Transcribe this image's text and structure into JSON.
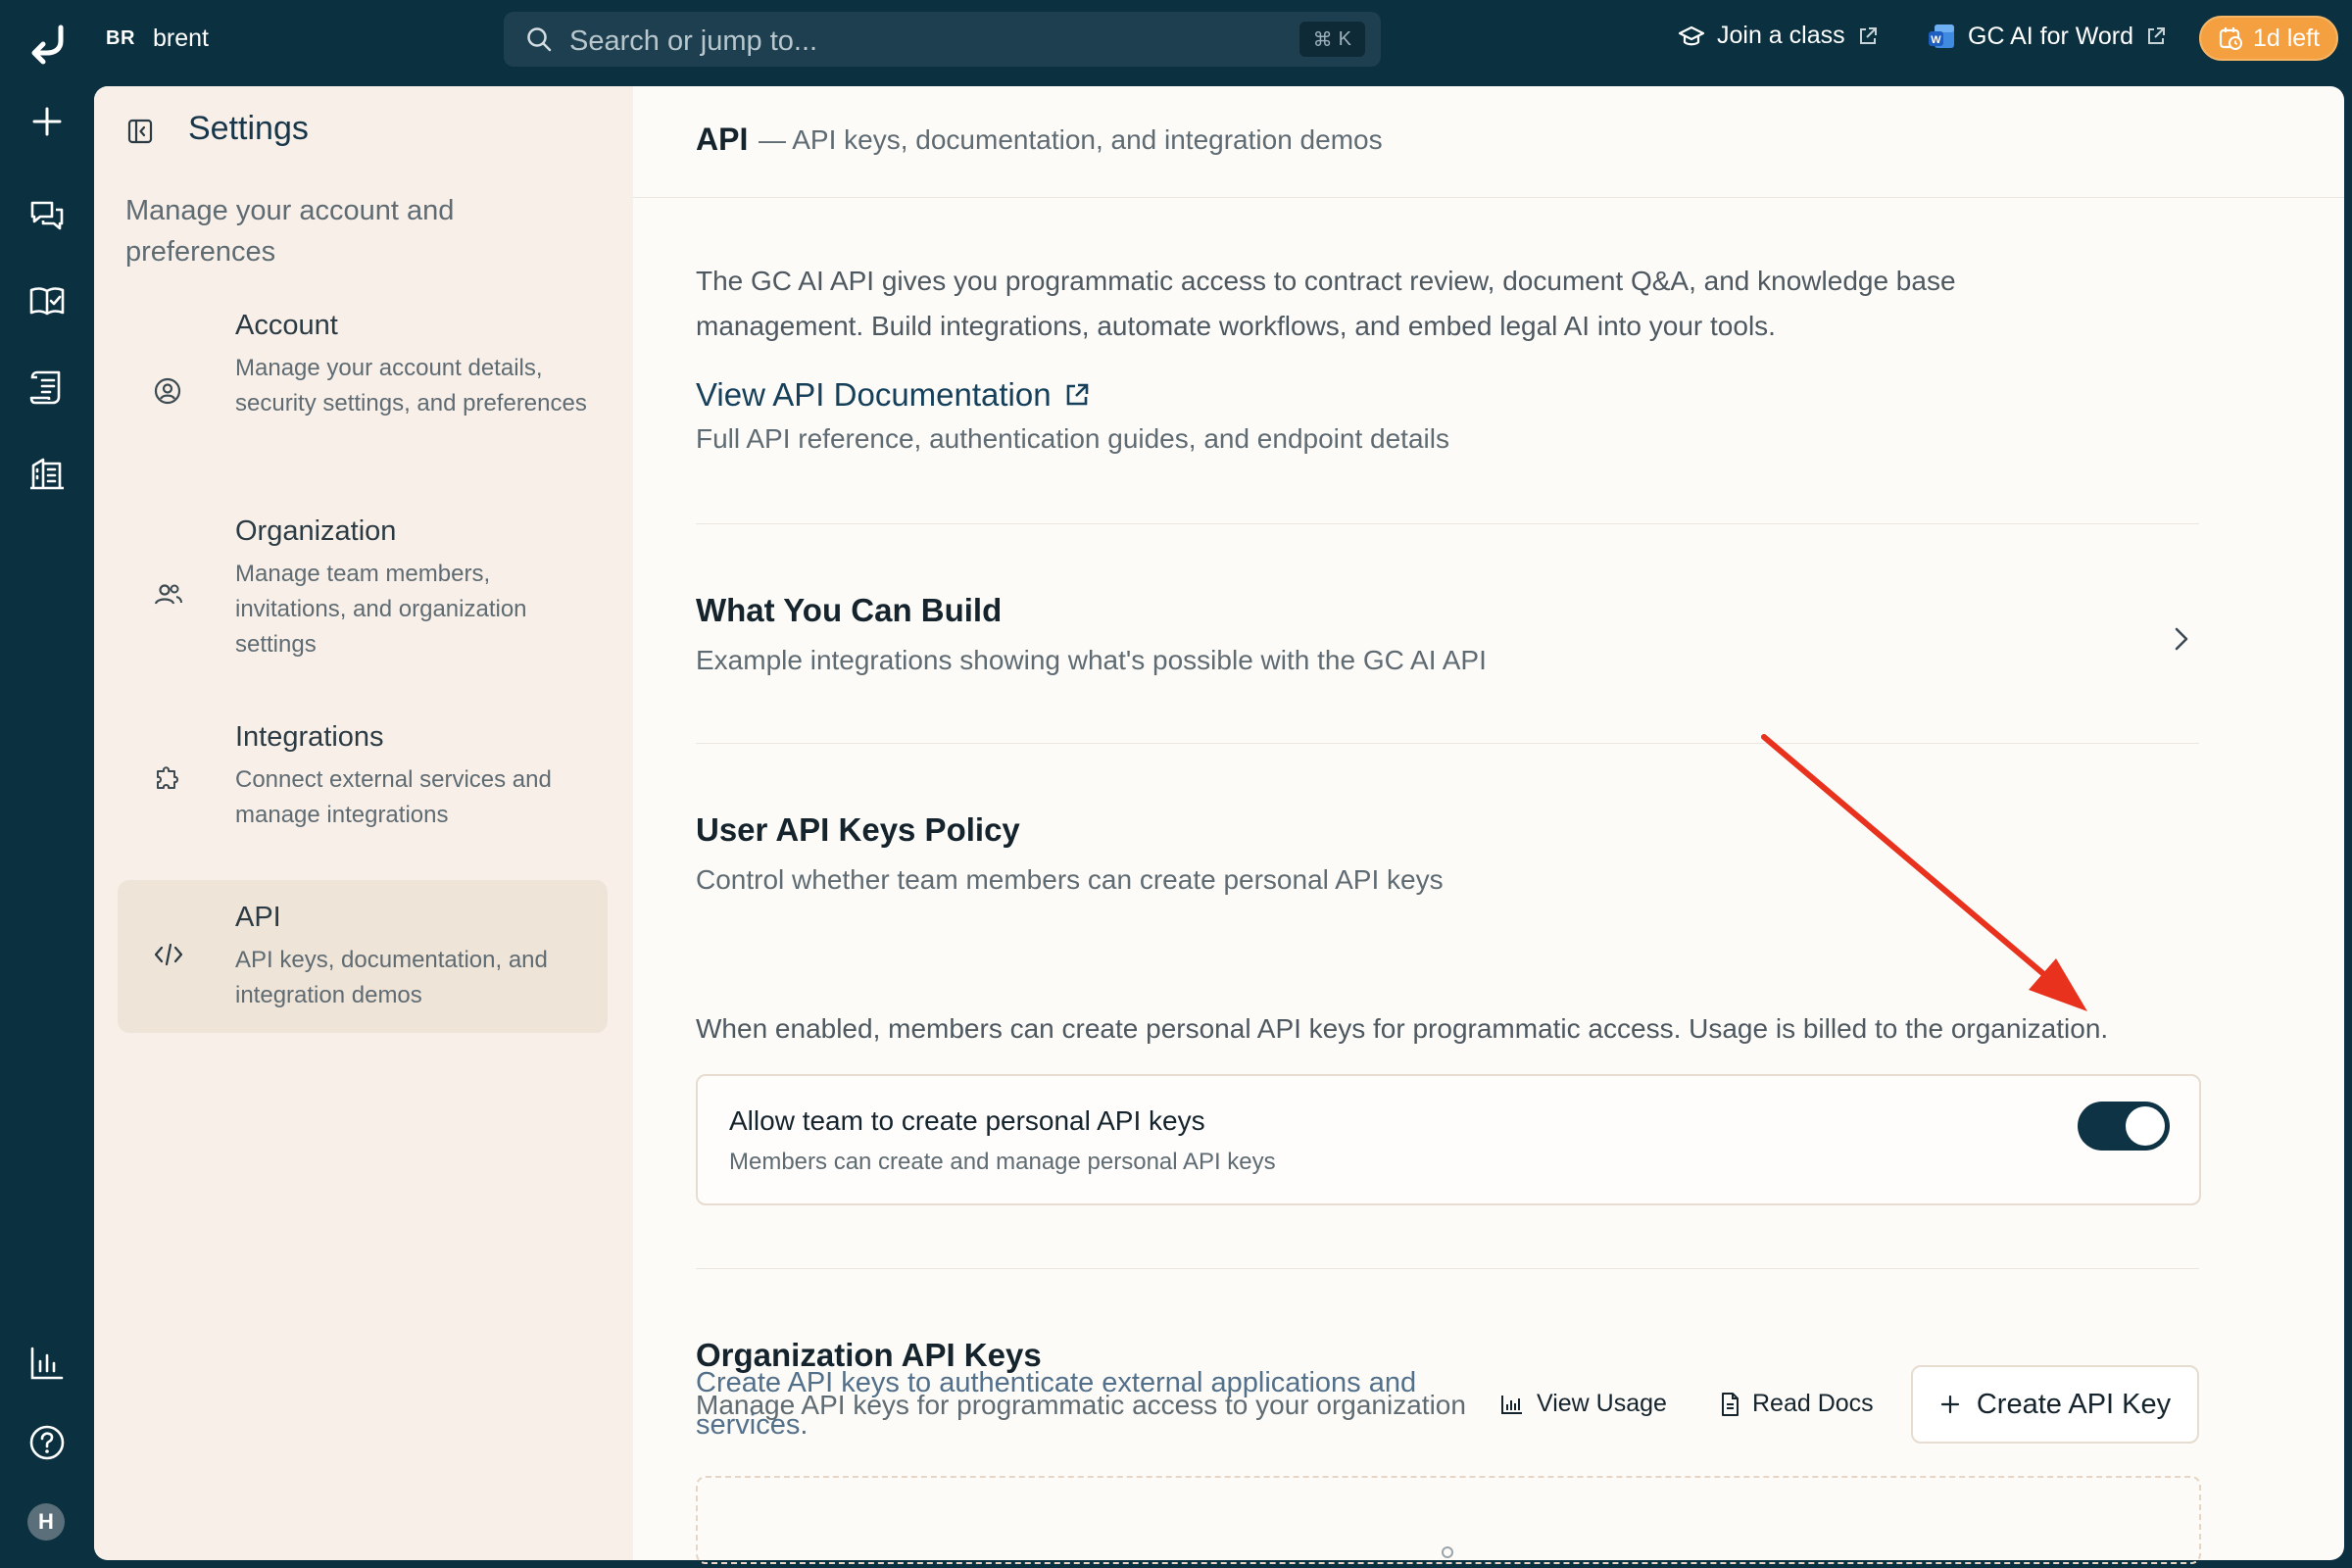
{
  "app": {
    "workspace_badge": "BR",
    "workspace_name": "brent"
  },
  "topbar": {
    "search_placeholder": "Search or jump to...",
    "search_shortcut_symbol": "⌘",
    "search_shortcut_key": "K",
    "join_class_label": "Join a class",
    "word_addin_label": "GC AI for Word",
    "trial_label": "1d left"
  },
  "rail": {
    "icons": [
      "reply-logo-icon",
      "plus-icon",
      "chats-icon",
      "library-icon",
      "scroll-icon",
      "building-icon",
      "analytics-icon",
      "help-icon"
    ],
    "avatar_initial": "H"
  },
  "settings_sidebar": {
    "title": "Settings",
    "description": "Manage your account and preferences",
    "items": [
      {
        "title": "Account",
        "subtitle": "Manage your account details, security settings, and preferences",
        "icon": "user-circle-icon"
      },
      {
        "title": "Organization",
        "subtitle": "Manage team members, invitations, and organization settings",
        "icon": "users-icon"
      },
      {
        "title": "Integrations",
        "subtitle": "Connect external services and manage integrations",
        "icon": "puzzle-icon"
      },
      {
        "title": "API",
        "subtitle": "API keys, documentation, and integration demos",
        "icon": "code-icon",
        "active": true
      }
    ]
  },
  "page": {
    "title": "API",
    "subtitle": "— API keys, documentation, and integration demos",
    "intro": "The GC AI API gives you programmatic access to contract review, document Q&A, and knowledge base management. Build integrations, automate workflows, and embed legal AI into your tools.",
    "docs_link": "View API Documentation",
    "docs_sub": "Full API reference, authentication guides, and endpoint details",
    "build_title": "What You Can Build",
    "build_sub": "Example integrations showing what's possible with the GC AI API",
    "policy_title": "User API Keys Policy",
    "policy_sub": "Control whether team members can create personal API keys",
    "policy_note": "When enabled, members can create personal API keys for programmatic access. Usage is billed to the organization.",
    "toggle": {
      "label": "Allow team to create personal API keys",
      "sub": "Members can create and manage personal API keys",
      "enabled": true
    },
    "org_keys_title": "Organization API Keys",
    "org_keys_sub": "Manage API keys for programmatic access to your organization",
    "org_keys_note": "Create API keys to authenticate external applications and services.",
    "view_usage_label": "View Usage",
    "read_docs_label": "Read Docs",
    "create_key_label": "Create API Key"
  },
  "colors": {
    "shell": "#0b3040",
    "accent_orange": "#f5a040",
    "toggle_on": "#0e3344",
    "annotation_arrow": "#e8321e"
  }
}
